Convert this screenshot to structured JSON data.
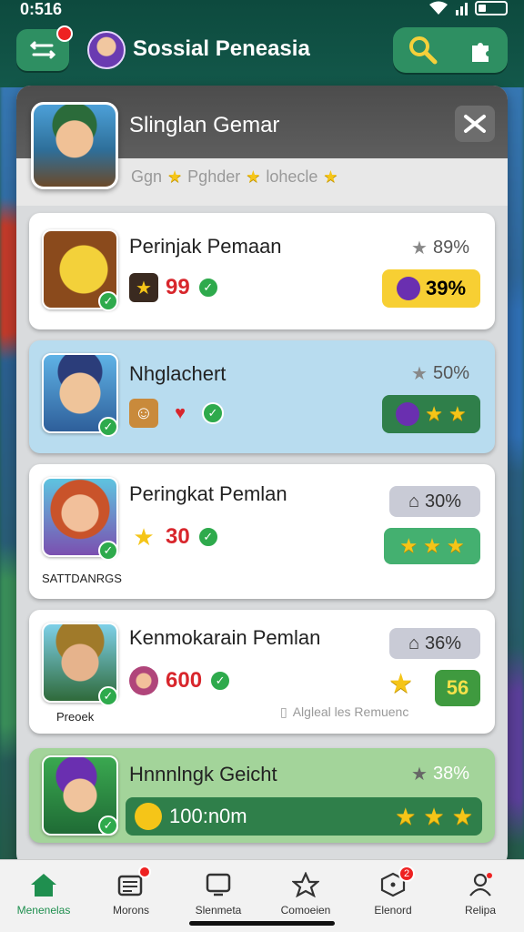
{
  "status_bar": {
    "time": "0:516"
  },
  "header": {
    "title": "Sossial Peneasia",
    "menu_badge": "",
    "colors": {
      "bar": "#13584a",
      "button": "#2e8f62"
    }
  },
  "panel": {
    "title": "Slinglan Gemar",
    "tagline": {
      "prefix": "Ggn",
      "middle": "Pghder",
      "suffix": "lohecle"
    }
  },
  "cards": [
    {
      "title": "Perinjak Pemaan",
      "stat_value": "99",
      "top_pct": "89%",
      "pill_text": "39%",
      "pill_color": "#f7cf33"
    },
    {
      "title": "Nhglachert",
      "top_pct": "50%",
      "pill_stars": 2,
      "pill_color": "#2f7f4a"
    },
    {
      "title": "Peringkat Pemlan",
      "stat_value": "30",
      "top_pct": "30%",
      "pill_stars": 3,
      "pill_color": "#44b070",
      "caption": "SATTDANRGS"
    },
    {
      "title": "Kenmokarain Pemlan",
      "stat_value": "600",
      "top_pct": "36%",
      "badge_value": "56",
      "caption": "Preoek",
      "footnote": "Algleal les Remuenc"
    },
    {
      "title": "Hnnnlngk Geicht",
      "top_pct": "38%",
      "bar_value": "100:n0m",
      "bar_stars": 3
    }
  ],
  "bottom_nav": [
    {
      "label": "Menenelas",
      "icon": "home-icon",
      "active": true
    },
    {
      "label": "Morons",
      "icon": "news-icon",
      "badge": ""
    },
    {
      "label": "Slenmeta",
      "icon": "screen-icon"
    },
    {
      "label": "Comoeien",
      "icon": "star-outline-icon"
    },
    {
      "label": "Elenord",
      "icon": "dice-icon",
      "badge": "2"
    },
    {
      "label": "Relipa",
      "icon": "profile-icon"
    }
  ]
}
